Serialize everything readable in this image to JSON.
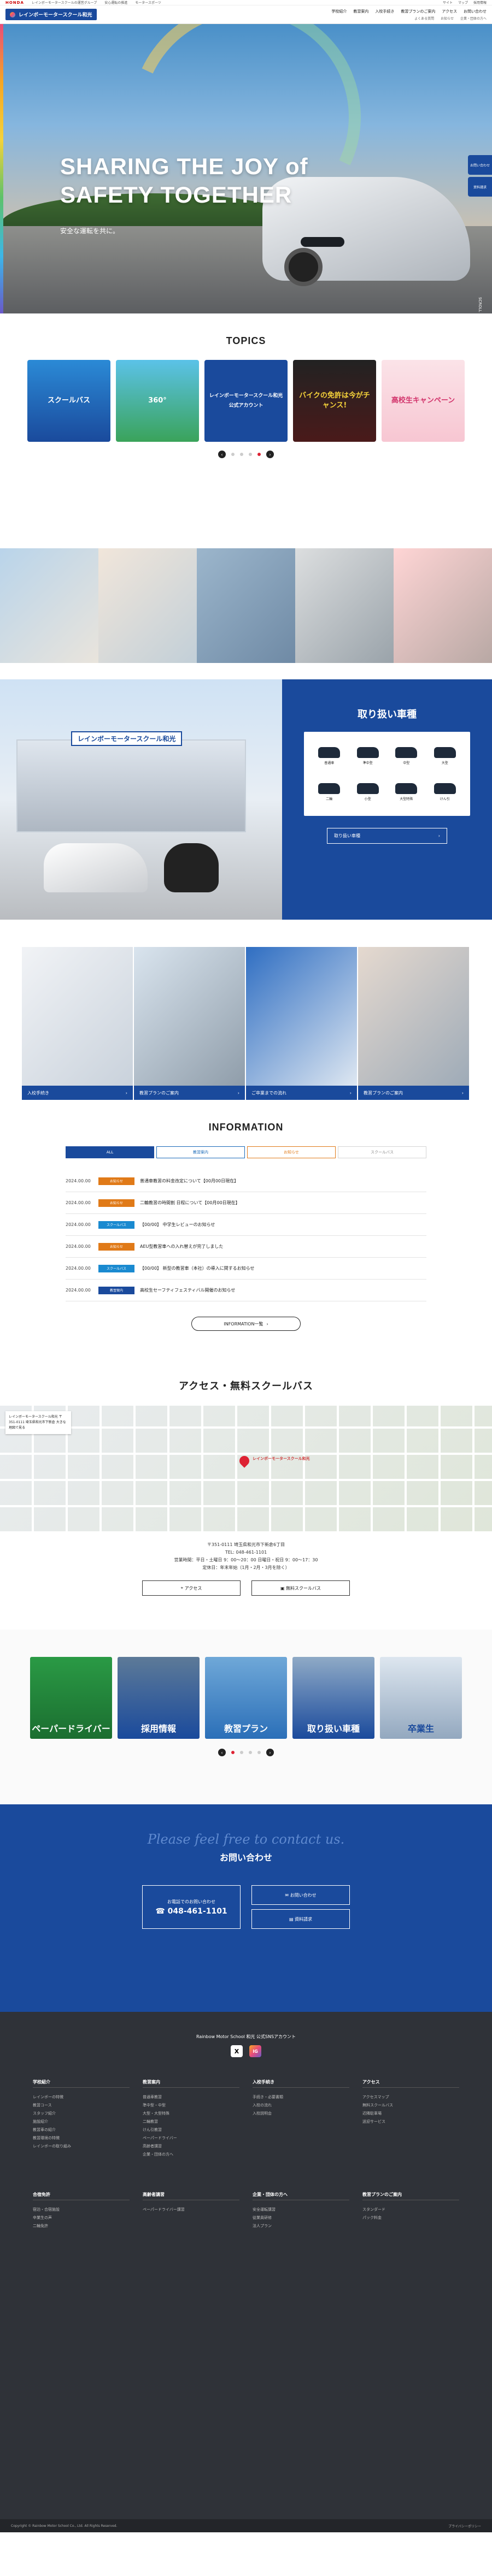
{
  "topbar": {
    "brand": "HONDA",
    "links": [
      "レインボーモータースクールの運営グループ",
      "安心運転の推進",
      "モータースポーツ"
    ],
    "right": [
      "サイト",
      "マップ",
      "採用情報"
    ]
  },
  "header": {
    "logo": "レインボーモータースクール和光",
    "nav_main": [
      "学校紹介",
      "教習案内",
      "入校手続き",
      "教習プランのご案内",
      "アクセス",
      "お問い合わせ"
    ],
    "nav_sub": [
      "よくある質問",
      "お知らせ",
      "企業・団体の方へ"
    ]
  },
  "hero": {
    "headline_1": "SHARING THE JOY of",
    "headline_2": "SAFETY TOGETHER",
    "tagline": "安全な運転を共に。",
    "scroll": "SCROLL"
  },
  "side_ctas": [
    "お問い合わせ",
    "資料請求"
  ],
  "topics": {
    "title": "TOPICS",
    "cards": [
      {
        "label": "スクールバス"
      },
      {
        "label": "360°"
      },
      {
        "label": "レインボーモータースクール和光 公式アカウント"
      },
      {
        "label": "バイクの免許は今がチャンス!"
      },
      {
        "label": "高校生キャンペーン"
      }
    ]
  },
  "vehicles": {
    "title": "取り扱い車種",
    "items": [
      "普通車",
      "準中型",
      "中型",
      "大型",
      "二輪",
      "小型",
      "大型特殊",
      "けん引"
    ],
    "button": "取り扱い車種"
  },
  "quad": [
    "入校手続き",
    "教習プランのご案内",
    "ご卒業までの流れ",
    "教習プランのご案内"
  ],
  "info": {
    "title": "INFORMATION",
    "tabs": [
      "ALL",
      "教習案内",
      "お知らせ",
      "スクールバス"
    ],
    "rows": [
      {
        "date": "2024.00.00",
        "badge": "お知らせ",
        "text": "普通車教習の料金改定について【00月00日現在】"
      },
      {
        "date": "2024.00.00",
        "badge": "お知らせ",
        "text": "二輪教習の時間割 日程について【00月00日現在】"
      },
      {
        "date": "2024.00.00",
        "badge": "スクールバス",
        "text": "【00/00】 中学生レビューのお知らせ"
      },
      {
        "date": "2024.00.00",
        "badge": "お知らせ",
        "text": "AEU型教習車への入れ替えが完了しました"
      },
      {
        "date": "2024.00.00",
        "badge": "スクールバス",
        "text": "【00/00】 新型の教習車（本社）の導入に関するお知らせ"
      },
      {
        "date": "2024.00.00",
        "badge": "教習案内",
        "text": "高校生セーフティフェスティバル開催のお知らせ"
      }
    ],
    "more": "INFORMATION一覧"
  },
  "access": {
    "title": "アクセス・無料スクールバス",
    "map_label": "レインボーモータースクール和光",
    "map_box": "レインボーモータースクール和光 〒351-0111 埼玉県和光市下新倉 大きな地図で見る",
    "address": "〒351-0111 埼玉県和光市下新倉6丁目",
    "tel": "TEL: 048-461-1101",
    "hours": "営業時間：平日・土曜日 9：00〜20：00 日曜日・祝日 9：00〜17：30",
    "closed": "定休日：年末年始（1月・2月・3月を除く）",
    "buttons": [
      "アクセス",
      "無料スクールバス"
    ]
  },
  "banners": [
    "ペーパードライバー",
    "採用情報",
    "教習プラン",
    "取り扱い車種",
    "卒業生"
  ],
  "contact": {
    "script": "Please feel free to contact us.",
    "title": "お問い合わせ",
    "tel_label": "お電話でのお問い合わせ",
    "tel": "048-461-1101",
    "links": [
      "お問い合わせ",
      "資料請求"
    ]
  },
  "footer": {
    "account_label": "Rainbow Motor School 和光 公式SNSアカウント",
    "social": [
      "X",
      "IG"
    ],
    "cols": [
      {
        "title": "学校紹介",
        "items": [
          "レインボーの特徴",
          "教習コース",
          "スタッフ紹介",
          "施設紹介",
          "教習車の紹介",
          "教習環境の特徴",
          "レインボーの取り組み"
        ]
      },
      {
        "title": "教習案内",
        "items": [
          "普通車教習",
          "準中型・中型",
          "大型・大型特殊",
          "二輪教習",
          "けん引教習",
          "ペーパードライバー",
          "高齢者講習",
          "企業・団体の方へ"
        ]
      },
      {
        "title": "入校手続き",
        "items": [
          "手続き・必要書類",
          "入校の流れ",
          "入校説明会"
        ]
      },
      {
        "title": "アクセス",
        "items": [
          "アクセスマップ",
          "無料スクールバス",
          "近隣駐車場",
          "送迎サービス"
        ]
      }
    ],
    "cols2": [
      {
        "title": "合宿免許",
        "items": [
          "宿泊・合宿施設",
          "卒業生の声",
          "二輪免許"
        ]
      },
      {
        "title": "高齢者講習",
        "items": [
          "ペーパードライバー講習"
        ]
      },
      {
        "title": "企業・団体の方へ",
        "items": [
          "安全運転講習",
          "従業員研修",
          "法人プラン"
        ]
      },
      {
        "title": "教習プランのご案内",
        "items": [
          "スタンダード",
          "パック料金"
        ]
      }
    ],
    "copyright": "Copyright © Rainbow Motor School Co., Ltd. All Rights Reserved.",
    "privacy": "プライバシーポリシー"
  }
}
